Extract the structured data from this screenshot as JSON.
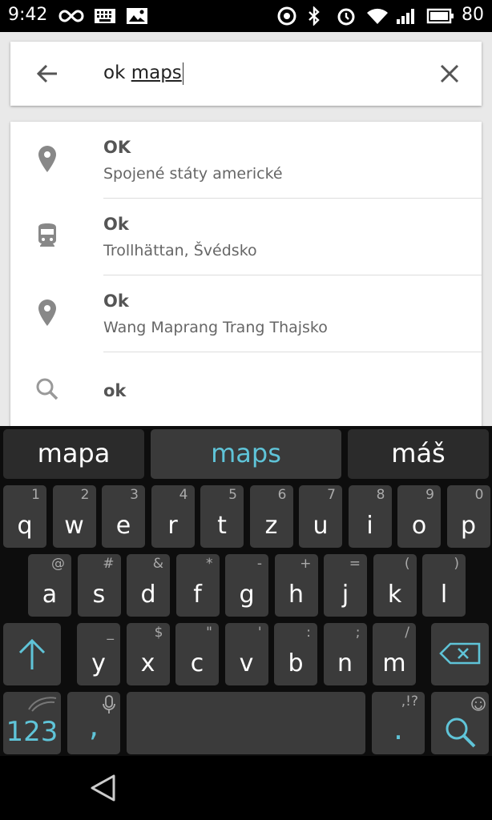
{
  "status_bar": {
    "time": "9:42",
    "battery": "80",
    "icons": [
      "infinity-icon",
      "keyboard-icon",
      "image-icon",
      "nfc-icon",
      "bluetooth-icon",
      "alarm-icon",
      "wifi-icon",
      "signal-icon",
      "battery-icon"
    ]
  },
  "search": {
    "query_first": "ok ",
    "query_second": "maps",
    "back_icon": "arrow-back-icon",
    "clear_icon": "close-icon"
  },
  "results": [
    {
      "icon": "place-icon",
      "title": "OK",
      "subtitle": "Spojené státy americké"
    },
    {
      "icon": "train-icon",
      "title": "Ok",
      "subtitle": "Trollhättan, Švédsko"
    },
    {
      "icon": "place-icon",
      "title": "Ok",
      "subtitle": "Wang Maprang Trang Thajsko"
    },
    {
      "icon": "search-icon",
      "title": "ok",
      "subtitle": ""
    }
  ],
  "keyboard": {
    "suggestions": [
      "mapa",
      "maps",
      "máš"
    ],
    "row1": [
      {
        "k": "q",
        "a": "1"
      },
      {
        "k": "w",
        "a": "2"
      },
      {
        "k": "e",
        "a": "3"
      },
      {
        "k": "r",
        "a": "4"
      },
      {
        "k": "t",
        "a": "5"
      },
      {
        "k": "z",
        "a": "6"
      },
      {
        "k": "u",
        "a": "7"
      },
      {
        "k": "i",
        "a": "8"
      },
      {
        "k": "o",
        "a": "9"
      },
      {
        "k": "p",
        "a": "0"
      }
    ],
    "row2": [
      {
        "k": "a",
        "a": "@"
      },
      {
        "k": "s",
        "a": "#"
      },
      {
        "k": "d",
        "a": "&"
      },
      {
        "k": "f",
        "a": "*"
      },
      {
        "k": "g",
        "a": "-"
      },
      {
        "k": "h",
        "a": "+"
      },
      {
        "k": "j",
        "a": "="
      },
      {
        "k": "k",
        "a": "("
      },
      {
        "k": "l",
        "a": ")"
      }
    ],
    "row3": [
      {
        "k": "y",
        "a": "_"
      },
      {
        "k": "x",
        "a": "$"
      },
      {
        "k": "c",
        "a": "\""
      },
      {
        "k": "v",
        "a": "'"
      },
      {
        "k": "b",
        "a": ":"
      },
      {
        "k": "n",
        "a": ";"
      },
      {
        "k": "m",
        "a": "/"
      }
    ],
    "numbers_label": "123",
    "comma_label": ",",
    "period_label": ".",
    "period_alt": ",!?",
    "accent_color": "#5fc4d8"
  }
}
